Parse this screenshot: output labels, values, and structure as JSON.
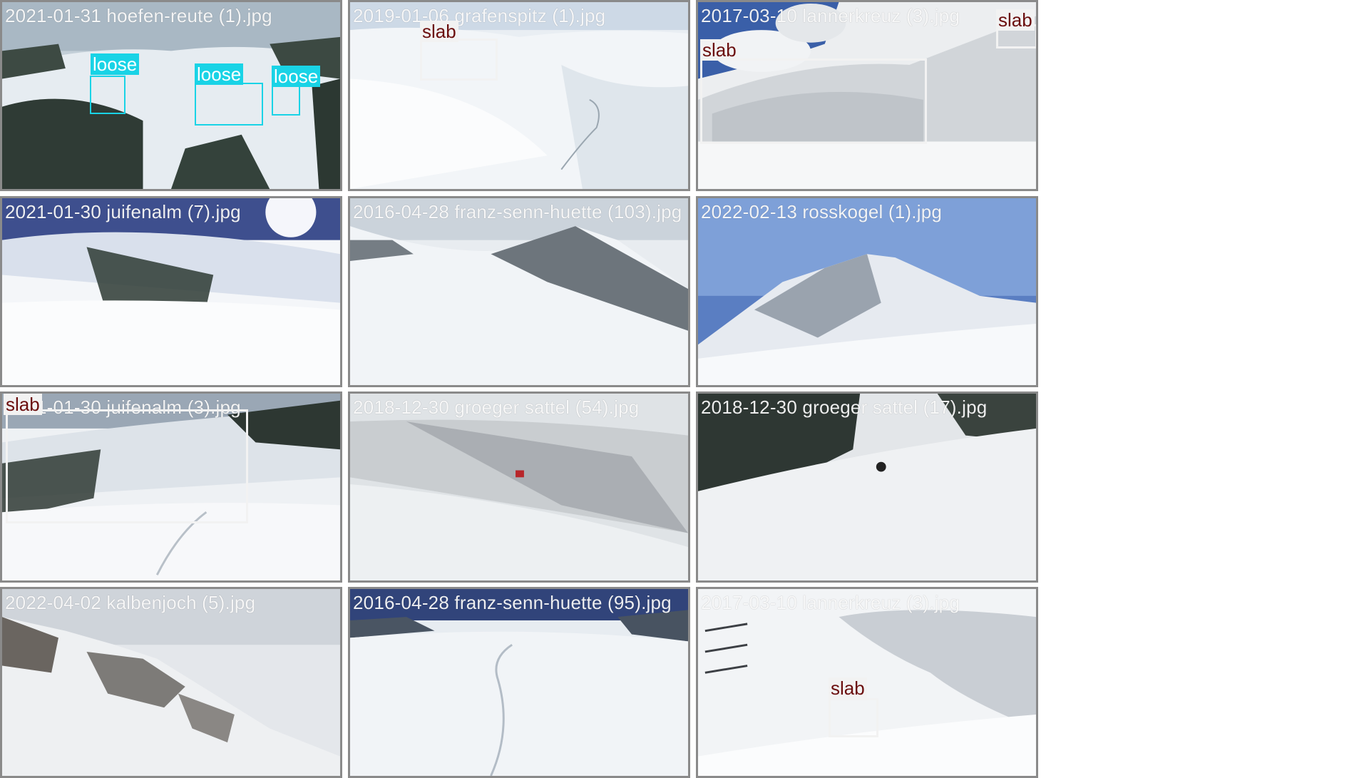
{
  "tiles": [
    {
      "filename": "2021-01-31 hoefen-reute (1).jpg",
      "scene": "snowy hillside with spruce forest and three loose-snow avalanche zones",
      "detections": [
        {
          "label": "loose"
        },
        {
          "label": "loose"
        },
        {
          "label": "loose"
        }
      ]
    },
    {
      "filename": "2019-01-06 grafenspitz (1).jpg",
      "scene": "wide snowy valley with ski tracks",
      "detections": [
        {
          "label": "slab"
        }
      ]
    },
    {
      "filename": "2017-03-10 lannerkreuz (3).jpg",
      "scene": "slab avalanche crown on a steep slope under cloudy blue sky",
      "detections": [
        {
          "label": "slab"
        },
        {
          "label": "slab"
        }
      ]
    },
    {
      "filename": "2021-01-30 juifenalm (7).jpg",
      "scene": "sunlit slope with conifer trees and ski tracks",
      "detections": []
    },
    {
      "filename": "2016-04-28 franz-senn-huette (103).jpg",
      "scene": "snowy ridge with rocky peak under overcast sky",
      "detections": []
    },
    {
      "filename": "2022-02-13 rosskogel (1).jpg",
      "scene": "mountain peak against blue sky",
      "detections": []
    },
    {
      "filename": "2021-01-30 juifenalm (3).jpg",
      "scene": "snowy slope with trees and ski tracks",
      "detections": [
        {
          "label": "slab"
        }
      ]
    },
    {
      "filename": "2018-12-30 groeger sattel (54).jpg",
      "scene": "skier on foggy forested slope",
      "detections": []
    },
    {
      "filename": "2018-12-30 groeger sattel (17).jpg",
      "scene": "skier on snowy slope with rocks and trees",
      "detections": []
    },
    {
      "filename": "2022-04-02 kalbenjoch (5).jpg",
      "scene": "rocky snowy mountain in mist",
      "detections": []
    },
    {
      "filename": "2016-04-28 franz-senn-huette (95).jpg",
      "scene": "glacier valley with ski track",
      "detections": []
    },
    {
      "filename": "2017-03-10 lannerkreuz (3).jpg",
      "scene": "overexposed slope with snow fences and small slab",
      "detections": [
        {
          "label": "slab"
        }
      ]
    }
  ]
}
